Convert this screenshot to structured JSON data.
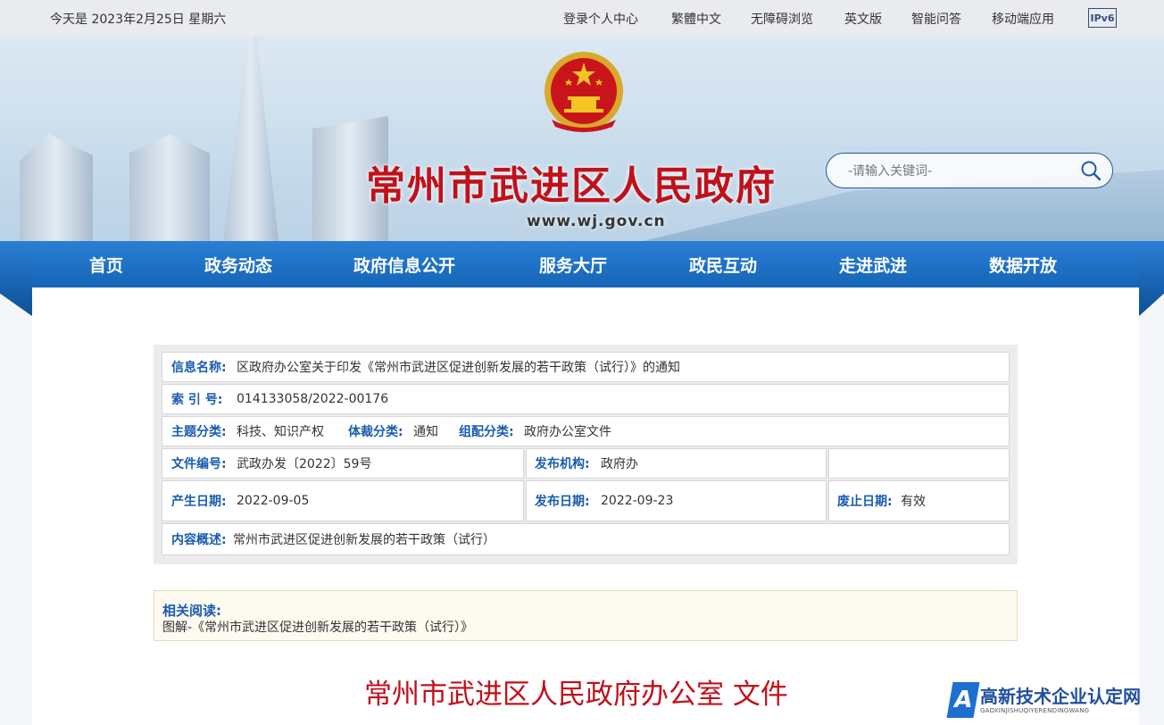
{
  "topbar": {
    "date": "今天是 2023年2月25日 星期六",
    "links": [
      "登录个人中心",
      "繁體中文",
      "无障碍浏览",
      "英文版",
      "智能问答",
      "移动端应用"
    ],
    "ipv6": "IPv6"
  },
  "header": {
    "title": "常州市武进区人民政府",
    "url": "www.wj.gov.cn",
    "search_placeholder": "-请输入关键词-",
    "search_icon": "search-icon",
    "emblem_icon": "national-emblem-icon"
  },
  "nav": [
    "首页",
    "政务动态",
    "政府信息公开",
    "服务大厅",
    "政民互动",
    "走进武进",
    "数据开放"
  ],
  "info": {
    "name_label": "信息名称:",
    "name_value": "区政府办公室关于印发《常州市武进区促进创新发展的若干政策（试行）》的通知",
    "index_label": "索 引 号:",
    "index_value": "014133058/2022-00176",
    "topic_label": "主题分类:",
    "topic_value": "科技、知识产权",
    "genre_label": "体裁分类:",
    "genre_value": "通知",
    "org_cat_label": "组配分类:",
    "org_cat_value": "政府办公室文件",
    "docno_label": "文件编号:",
    "docno_value": "武政办发〔2022〕59号",
    "publisher_label": "发布机构:",
    "publisher_value": "政府办",
    "created_label": "产生日期:",
    "created_value": "2022-09-05",
    "published_label": "发布日期:",
    "published_value": "2022-09-23",
    "expire_label": "废止日期:",
    "expire_value": "有效",
    "summary_label": "内容概述:",
    "summary_value": "常州市武进区促进创新发展的若干政策（试行）"
  },
  "related": {
    "heading": "相关阅读:",
    "link": "图解-《常州市武进区促进创新发展的若干政策（试行）》"
  },
  "document_title": "常州市武进区人民政府办公室 文件",
  "watermark": {
    "letter": "A",
    "title": "高新技术企业认定网",
    "subtitle": "GAOXINJISHUQIYERENDINGWANG"
  },
  "colors": {
    "nav_blue": "#1a6fc4",
    "title_red": "#c0111b",
    "label_blue": "#1a5bb0"
  }
}
